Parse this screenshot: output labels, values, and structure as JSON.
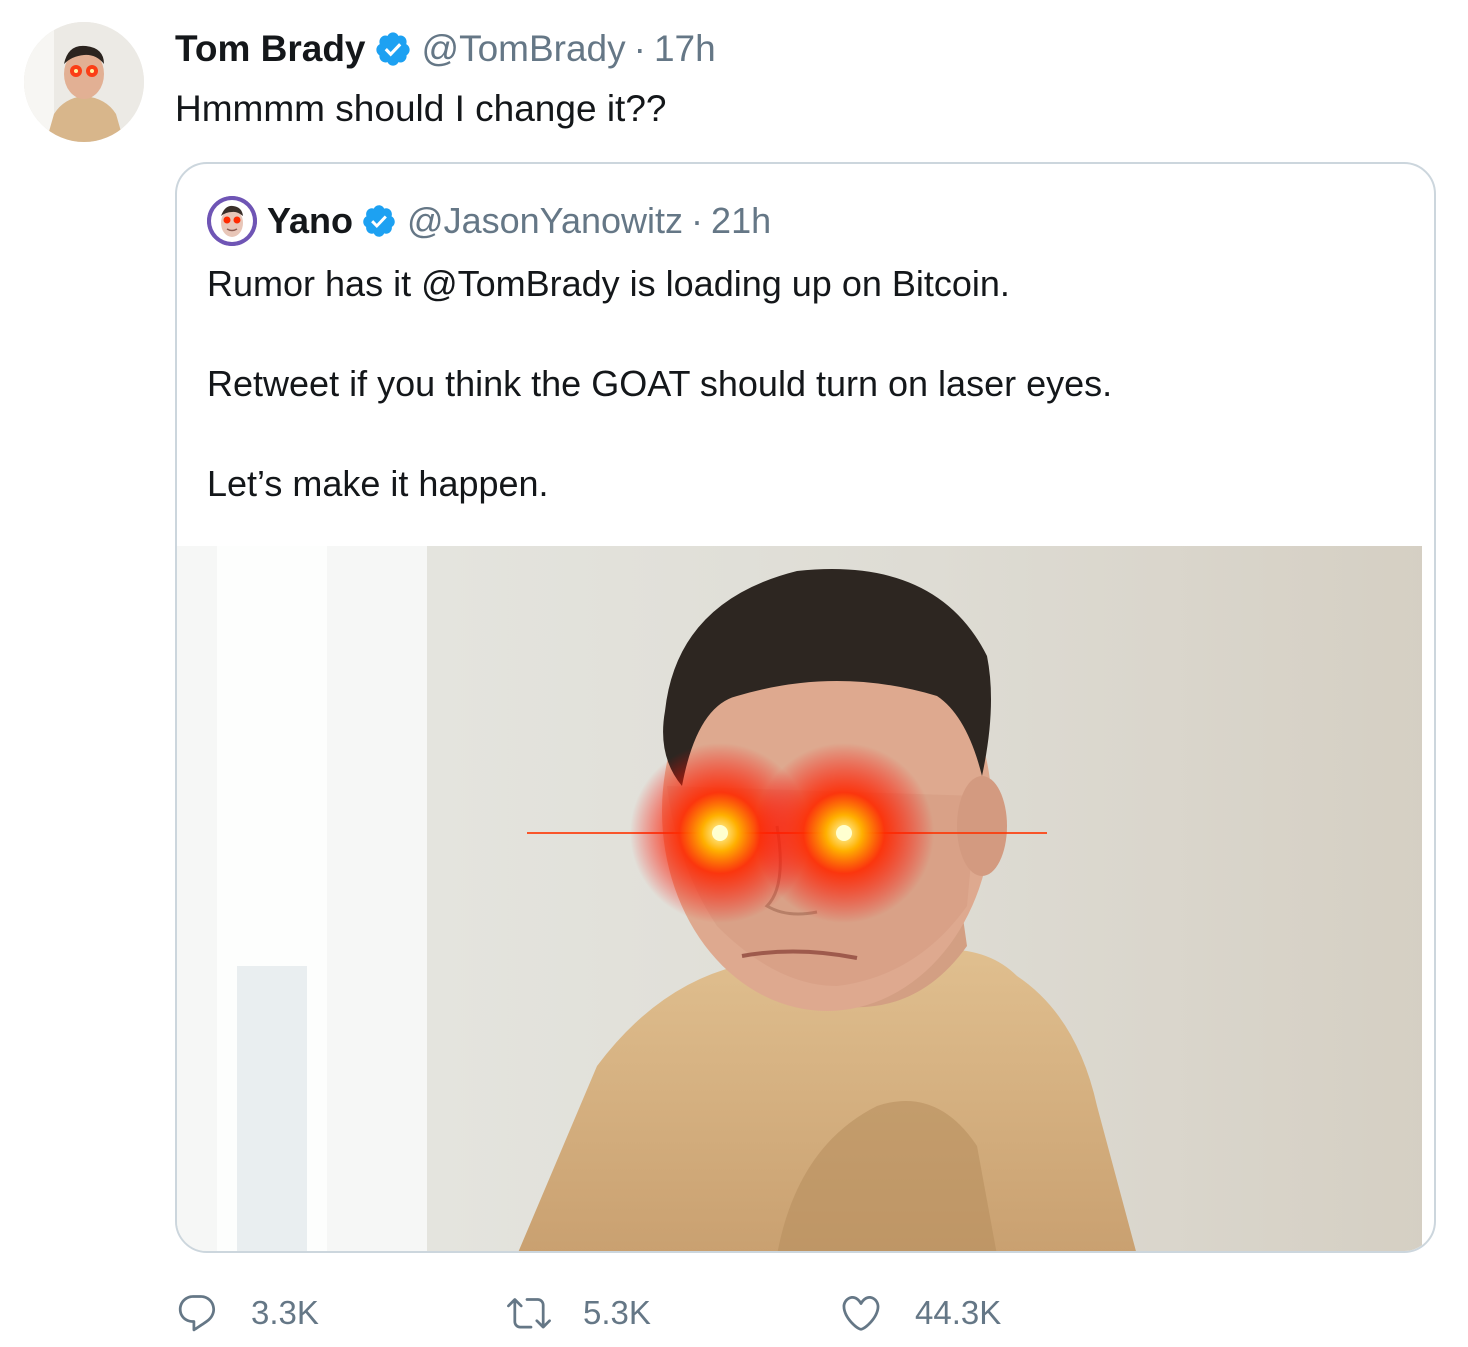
{
  "tweet": {
    "author_name": "Tom Brady",
    "handle": "@TomBrady",
    "separator": "·",
    "time": "17h",
    "text": "Hmmmm should I change it??"
  },
  "quoted": {
    "author_name": "Yano",
    "handle": "@JasonYanowitz",
    "separator": "·",
    "time": "21h",
    "lines": [
      "Rumor has it @TomBrady is loading up on Bitcoin.",
      "Retweet if you think the GOAT should turn on laser eyes.",
      "Let’s make it happen."
    ]
  },
  "actions": {
    "replies": "3.3K",
    "retweets": "5.3K",
    "likes": "44.3K"
  },
  "icons": {
    "verified": "verified-badge-icon",
    "reply": "reply-icon",
    "retweet": "retweet-icon",
    "like": "heart-icon"
  },
  "colors": {
    "verified": "#1da1f2",
    "secondary_text": "#657786",
    "border": "#ccd6dd",
    "laser": "#ff1a00"
  }
}
